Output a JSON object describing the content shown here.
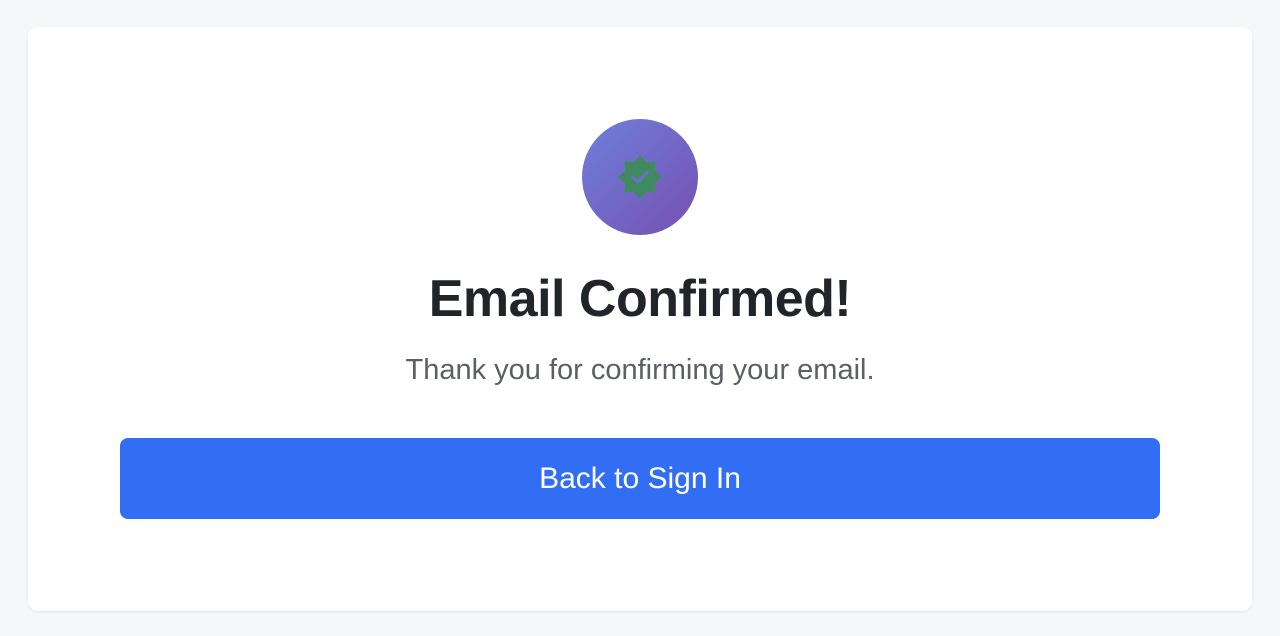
{
  "confirmation": {
    "title": "Email Confirmed!",
    "message": "Thank you for confirming your email.",
    "button_label": "Back to Sign In",
    "icon": "check-badge-icon"
  },
  "colors": {
    "background": "#f6f7f9",
    "card": "#ffffff",
    "icon_gradient_start": "#6f7fdc",
    "icon_gradient_end": "#7650b0",
    "badge": "#3f8a5e",
    "title": "#212529",
    "message": "#5c6065",
    "button": "#326ef4",
    "button_text": "#ffffff"
  }
}
